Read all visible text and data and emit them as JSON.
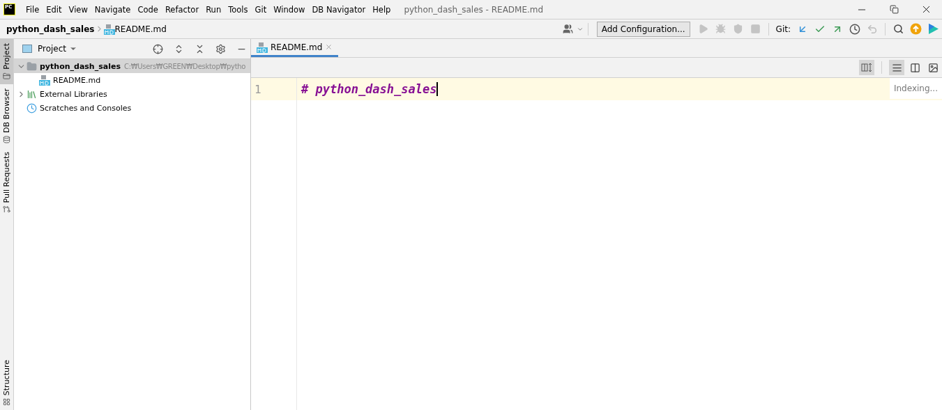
{
  "title_bar": {
    "logo": "PC",
    "menu": [
      "File",
      "Edit",
      "View",
      "Navigate",
      "Code",
      "Refactor",
      "Run",
      "Tools",
      "Git",
      "Window",
      "DB Navigator",
      "Help"
    ],
    "title": "python_dash_sales - README.md"
  },
  "breadcrumb": [
    {
      "label": "python_dash_sales",
      "kind": "project"
    },
    {
      "label": "README.md",
      "kind": "markdown"
    }
  ],
  "toolbar": {
    "config_button": "Add Configuration...",
    "run_actions": [
      {
        "kind": "run",
        "disabled": true
      },
      {
        "kind": "debug",
        "disabled": true
      },
      {
        "kind": "coverage",
        "disabled": true
      },
      {
        "kind": "stop",
        "disabled": true
      }
    ],
    "git_label": "Git:",
    "git_actions": [
      {
        "kind": "update",
        "disabled": false
      },
      {
        "kind": "commit",
        "disabled": false
      },
      {
        "kind": "push",
        "disabled": false
      },
      {
        "kind": "history",
        "disabled": false
      },
      {
        "kind": "rollback",
        "disabled": true
      }
    ]
  },
  "side_tabs_top": [
    {
      "label": "Project",
      "kind": "project",
      "selected": true
    },
    {
      "label": "DB Browser",
      "kind": "db",
      "selected": false
    },
    {
      "label": "Pull Requests",
      "kind": "pull",
      "selected": false
    }
  ],
  "side_tabs_bottom": [
    {
      "label": "Structure",
      "kind": "structure",
      "selected": false
    }
  ],
  "project_panel": {
    "title": "Project",
    "tree": [
      {
        "label": "python_dash_sales",
        "path": "C:₩Users₩GREEN₩Desktop₩pytho",
        "kind": "folder",
        "expanded": true,
        "selected": true,
        "children": [
          {
            "label": "README.md",
            "kind": "markdown",
            "selected": false
          }
        ]
      },
      {
        "label": "External Libraries",
        "kind": "libraries",
        "expanded": false,
        "selected": false
      },
      {
        "label": "Scratches and Consoles",
        "kind": "scratches",
        "selected": false
      }
    ]
  },
  "editor": {
    "tabs": [
      {
        "label": "README.md",
        "selected": true
      }
    ],
    "sync_scroll": {
      "on": true
    },
    "view_modes": [
      {
        "kind": "editor",
        "selected": true
      },
      {
        "kind": "split",
        "selected": false
      },
      {
        "kind": "preview",
        "selected": false
      }
    ],
    "lines": [
      {
        "number": "1",
        "text": "# python_dash_sales",
        "current": true
      }
    ],
    "status": "Indexing..."
  }
}
